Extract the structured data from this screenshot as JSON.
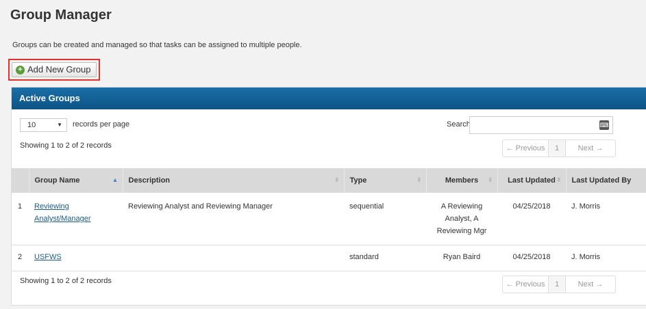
{
  "page": {
    "title": "Group Manager",
    "description": "Groups can be created and managed so that tasks can be assigned to multiple people.",
    "add_button": "Add New Group"
  },
  "panel": {
    "title": "Active Groups",
    "length_value": "10",
    "length_label": "records per page",
    "search_label": "Search:",
    "search_value": "",
    "showing": "Showing 1 to 2 of 2 records",
    "pager": {
      "prev": "← Previous",
      "page": "1",
      "next": "Next →"
    }
  },
  "table": {
    "columns": [
      "Group Name",
      "Description",
      "Type",
      "Members",
      "Last Updated",
      "Last Updated By"
    ],
    "rows": [
      {
        "num": "1",
        "name": "Reviewing Analyst/Manager",
        "description": "Reviewing Analyst and Reviewing Manager",
        "type": "sequential",
        "members": "A Reviewing Analyst, A Reviewing Mgr",
        "updated": "04/25/2018",
        "updated_by": "J. Morris"
      },
      {
        "num": "2",
        "name": "USFWS",
        "description": "",
        "type": "standard",
        "members": "Ryan Baird",
        "updated": "04/25/2018",
        "updated_by": "J. Morris"
      }
    ]
  }
}
